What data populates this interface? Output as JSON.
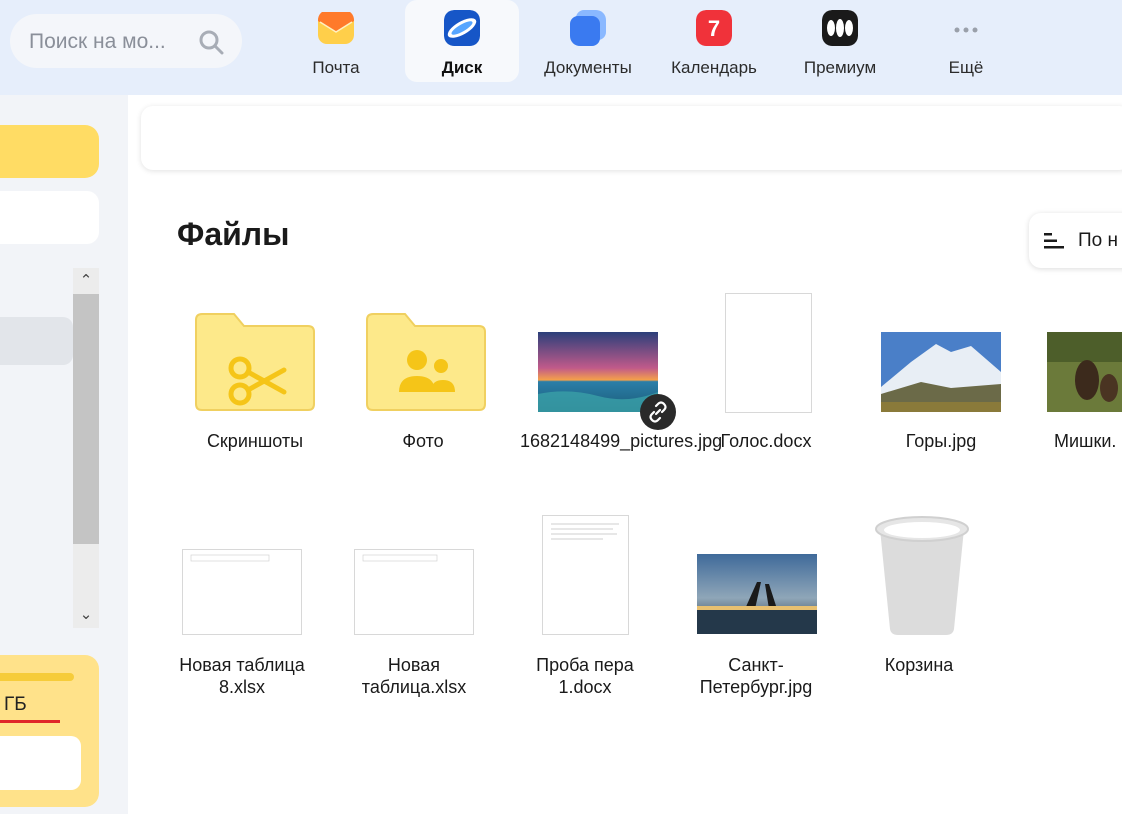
{
  "search": {
    "placeholder": "Поиск на мо..."
  },
  "apps": [
    {
      "label": "Почта",
      "icon": "mail-envelope-icon",
      "color": "#ffb735"
    },
    {
      "label": "Диск",
      "icon": "disk-icon",
      "color": "#1e6fe0",
      "active": true
    },
    {
      "label": "Документы",
      "icon": "documents-icon",
      "color": "#4a86f0"
    },
    {
      "label": "Календарь",
      "icon": "calendar-icon",
      "color": "#f0323a",
      "badge": "7"
    },
    {
      "label": "Премиум",
      "icon": "premium-icon",
      "color": "#1a1a1a"
    },
    {
      "label": "Ещё",
      "icon": "more-dots-icon"
    }
  ],
  "sidebar": {
    "storage_text": "ГБ"
  },
  "main": {
    "title": "Файлы",
    "sort_label": "По н",
    "files": [
      {
        "name": "Скриншоты",
        "type": "folder",
        "icon": "scissors-icon"
      },
      {
        "name": "Фото",
        "type": "folder",
        "icon": "people-icon"
      },
      {
        "name": "1682148499_pictures.jpg",
        "type": "image",
        "shared": true
      },
      {
        "name": "Голос.docx",
        "type": "document"
      },
      {
        "name": "Горы.jpg",
        "type": "image"
      },
      {
        "name": "Мишки.",
        "type": "image"
      },
      {
        "name": "Новая таблица 8.xlsx",
        "type": "spreadsheet"
      },
      {
        "name": "Новая таблица.xlsx",
        "type": "spreadsheet"
      },
      {
        "name": "Проба пера 1.docx",
        "type": "document"
      },
      {
        "name": "Санкт-Петербург.jpg",
        "type": "image"
      },
      {
        "name": "Корзина",
        "type": "trash",
        "icon": "trash-bin-icon"
      }
    ]
  },
  "colors": {
    "topbar_bg": "#e6eefb",
    "folder_fill": "#fde98a",
    "folder_stroke": "#f0d060",
    "folder_icon": "#f5c518",
    "storage_accent": "#e0262a"
  }
}
